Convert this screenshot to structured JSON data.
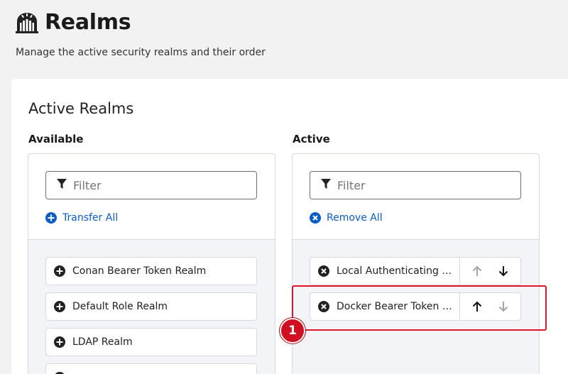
{
  "header": {
    "icon": "realm-gate-icon",
    "title": "Realms",
    "subtitle": "Manage the active security realms and their order"
  },
  "card": {
    "title": "Active Realms",
    "available": {
      "label": "Available",
      "filter_placeholder": "Filter",
      "transfer_all": "Transfer All",
      "items": [
        {
          "label": "Conan Bearer Token Realm"
        },
        {
          "label": "Default Role Realm"
        },
        {
          "label": "LDAP Realm"
        }
      ]
    },
    "active": {
      "label": "Active",
      "filter_placeholder": "Filter",
      "remove_all": "Remove All",
      "items": [
        {
          "label": "Local Authenticating Realm"
        },
        {
          "label": "Docker Bearer Token Realm"
        }
      ]
    }
  },
  "annotation": {
    "badge": "1",
    "color": "#e0142a"
  },
  "colors": {
    "link": "#0a5cc5",
    "background": "#f2f2f2",
    "list_background": "#f3f4f8"
  }
}
